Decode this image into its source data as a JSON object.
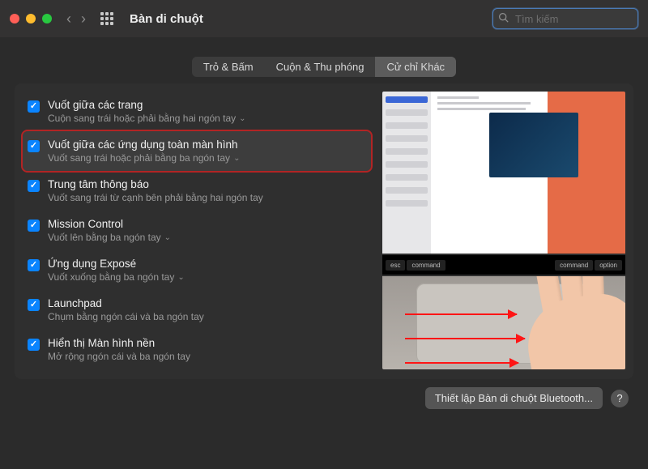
{
  "window": {
    "title": "Bàn di chuột",
    "traffic_colors": {
      "close": "#ff5f57",
      "min": "#febc2e",
      "max": "#28c840"
    },
    "search_placeholder": "Tìm kiếm"
  },
  "tabs": [
    {
      "label": "Trỏ & Bấm",
      "active": false
    },
    {
      "label": "Cuộn & Thu phóng",
      "active": false
    },
    {
      "label": "Cử chỉ Khác",
      "active": true
    }
  ],
  "options": [
    {
      "title": "Vuốt giữa các trang",
      "sub": "Cuộn sang trái hoặc phải bằng hai ngón tay",
      "checked": true,
      "dropdown": true,
      "highlighted": false
    },
    {
      "title": "Vuốt giữa các ứng dụng toàn màn hình",
      "sub": "Vuốt sang trái hoặc phải bằng ba ngón tay",
      "checked": true,
      "dropdown": true,
      "highlighted": true
    },
    {
      "title": "Trung tâm thông báo",
      "sub": "Vuốt sang trái từ cạnh bên phải bằng hai ngón tay",
      "checked": true,
      "dropdown": false,
      "highlighted": false
    },
    {
      "title": "Mission Control",
      "sub": "Vuốt lên bằng ba ngón tay",
      "checked": true,
      "dropdown": true,
      "highlighted": false
    },
    {
      "title": "Ứng dụng Exposé",
      "sub": "Vuốt xuống bằng ba ngón tay",
      "checked": true,
      "dropdown": true,
      "highlighted": false
    },
    {
      "title": "Launchpad",
      "sub": "Chụm bằng ngón cái và ba ngón tay",
      "checked": true,
      "dropdown": false,
      "highlighted": false
    },
    {
      "title": "Hiển thị Màn hình nền",
      "sub": "Mở rộng ngón cái và ba ngón tay",
      "checked": true,
      "dropdown": false,
      "highlighted": false
    }
  ],
  "touchbar_keys_left": [
    "esc",
    "command"
  ],
  "touchbar_keys_right": [
    "command",
    "option"
  ],
  "footer": {
    "setup_button": "Thiết lập Bàn di chuột Bluetooth...",
    "help": "?"
  },
  "accent_color": "#0a84ff"
}
